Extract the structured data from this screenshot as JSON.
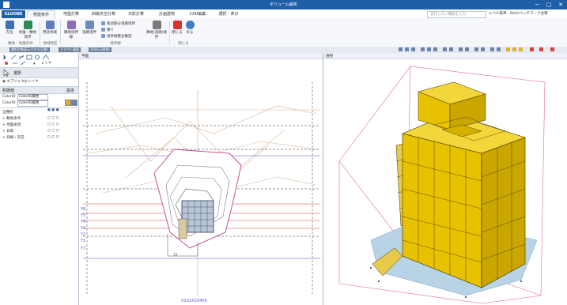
{
  "window": {
    "title": "ボリューム解析",
    "minimize": "─",
    "maximize": "□",
    "close": "✕"
  },
  "tabs": [
    {
      "label": "GLOOBE",
      "kind": "file"
    },
    {
      "label": "発建条件",
      "kind": "normal"
    },
    {
      "label": "地盤計算",
      "kind": "normal"
    },
    {
      "label": "斜線天空計算",
      "kind": "normal"
    },
    {
      "label": "日影計算",
      "kind": "normal"
    },
    {
      "label": "計画建物",
      "kind": "normal"
    },
    {
      "label": "CAD編集",
      "kind": "normal"
    },
    {
      "label": "選択・表示",
      "kind": "normal"
    }
  ],
  "search": {
    "placeholder": "実行したい機能を入力"
  },
  "level": {
    "text": "レベル基準：8mh/ベンチマーク台帳"
  },
  "ribbon": {
    "buttons": [
      {
        "label": "方位",
        "color": "#3f6fb5"
      },
      {
        "label": "地盤・敷地境界",
        "color": "#2e8b57"
      },
      {
        "label": "用途地域",
        "color": "#5b7fbf"
      },
      {
        "label": "隣地境界線",
        "color": "#8a6fb5"
      },
      {
        "label": "道路境界",
        "color": "#6a8cc0"
      },
      {
        "label": "隣地(道路)境界",
        "color": "#7a7a7a"
      },
      {
        "label": "閉じる",
        "color": "#d9342b"
      },
      {
        "label": "戻る",
        "color": "#3f7fc4"
      }
    ],
    "small_items": [
      "後退部分道路境界",
      "隣り",
      "境界線整合確認"
    ],
    "groups": [
      "敷地・地盤条件",
      "地域地区",
      "境界線",
      "閉じる"
    ]
  },
  "doc_tabs": [
    "選択対象表示パネル(日影)",
    "ドラフト図面",
    "3D表示(透視)"
  ],
  "left_panel": {
    "tool_label": "選択",
    "radio": [
      "オブジェクト",
      "レイヤ"
    ],
    "props_title": "初期値",
    "props_btn": "設定",
    "color_rows": [
      {
        "key": "ColorID",
        "value": "ColorID属性"
      },
      {
        "key": "ColorID",
        "value": "ColorID属性"
      }
    ],
    "layer_title": "全種別",
    "layers": [
      "敷地条件",
      "地盤表現",
      "日影",
      "斜線・天空"
    ],
    "dropdown_label": "レイヤ"
  },
  "view2d": {
    "title": "平面",
    "y_labels": [
      "Y6",
      "Y5",
      "Y4",
      "Y3",
      "Y2",
      "Y1",
      "Y7"
    ],
    "x_label": "X1X2X3X4X5"
  },
  "view3d": {
    "title": "透視"
  }
}
